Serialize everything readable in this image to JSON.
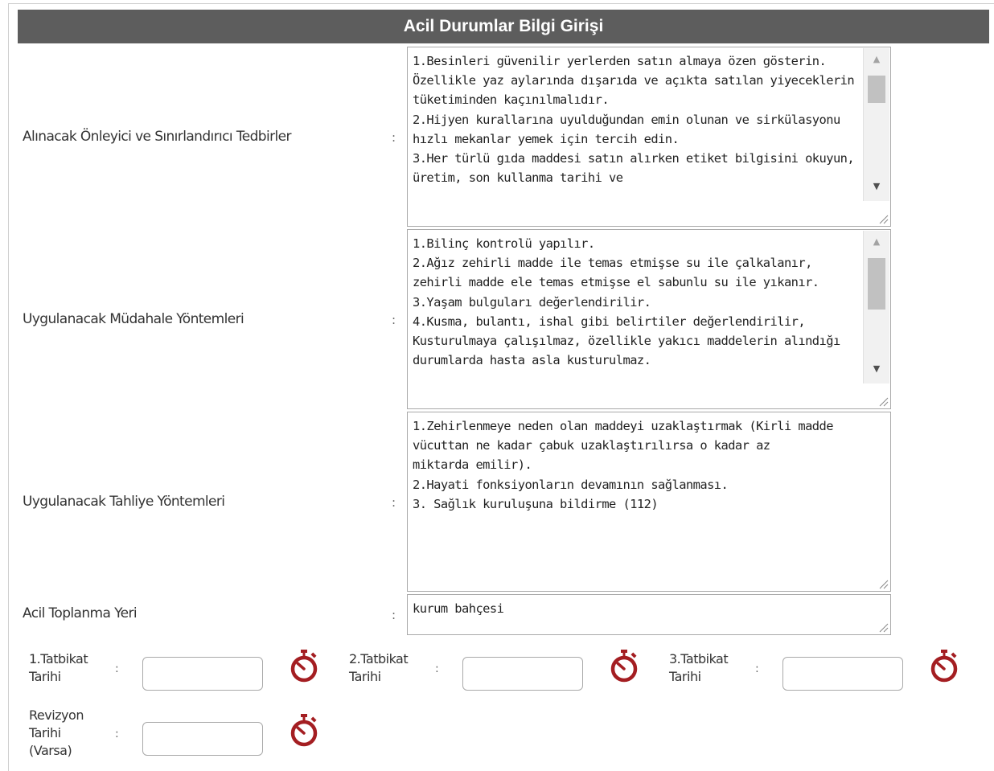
{
  "header": {
    "title": "Acil Durumlar Bilgi Girişi"
  },
  "separator": ":",
  "fields": {
    "onleyici": {
      "label": "Alınacak Önleyici ve Sınırlandırıcı Tedbirler",
      "value": "1.Besinleri güvenilir yerlerden satın almaya özen gösterin. Özellikle yaz aylarında dışarıda ve açıkta satılan yiyeceklerin tüketiminden kaçınılmalıdır.\n2.Hijyen kurallarına uyulduğundan emin olunan ve sirkülasyonu hızlı mekanlar yemek için tercih edin.\n3.Her türlü gıda maddesi satın alırken etiket bilgisini okuyun, üretim, son kullanma tarihi ve"
    },
    "mudahale": {
      "label": "Uygulanacak Müdahale Yöntemleri",
      "value": "1.Bilinç kontrolü yapılır.\n2.Ağız zehirli madde ile temas etmişse su ile çalkalanır, zehirli madde ele temas etmişse el sabunlu su ile yıkanır.\n3.Yaşam bulguları değerlendirilir.\n4.Kusma, bulantı, ishal gibi belirtiler değerlendirilir, Kusturulmaya çalışılmaz, özellikle yakıcı maddelerin alındığı durumlarda hasta asla kusturulmaz."
    },
    "tahliye": {
      "label": "Uygulanacak Tahliye Yöntemleri",
      "value": "1.Zehirlenmeye neden olan maddeyi uzaklaştırmak (Kirli madde vücuttan ne kadar çabuk uzaklaştırılırsa o kadar az\nmiktarda emilir).\n2.Hayati fonksiyonların devamının sağlanması.\n3. Sağlık kuruluşuna bildirme (112)"
    },
    "toplanma": {
      "label": "Acil Toplanma Yeri",
      "value": "kurum bahçesi"
    }
  },
  "dates": {
    "tatbikat1": {
      "label_line1": "1.Tatbikat",
      "label_line2": "Tarihi",
      "value": ""
    },
    "tatbikat2": {
      "label_line1": "2.Tatbikat",
      "label_line2": "Tarihi",
      "value": ""
    },
    "tatbikat3": {
      "label_line1": "3.Tatbikat",
      "label_line2": "Tarihi",
      "value": ""
    },
    "revizyon": {
      "label_line1": "Revizyon",
      "label_line2": "Tarihi",
      "label_line3": "(Varsa)",
      "value": ""
    }
  },
  "icons": {
    "date_picker": "stopwatch-icon",
    "accent": "#a41e22"
  }
}
